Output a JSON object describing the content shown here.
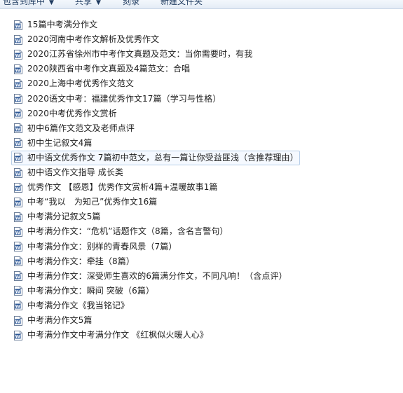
{
  "toolbar": {
    "include_label": "包含到库中",
    "share_label": "共享",
    "burn_label": "刻录",
    "new_folder_label": "新建文件夹"
  },
  "files": [
    {
      "name": "15篇中考满分作文",
      "icon": "word-doc-icon"
    },
    {
      "name": "2020河南中考作文解析及优秀作文",
      "icon": "word-doc-icon"
    },
    {
      "name": "2020江苏省徐州市中考作文真题及范文：当你需要时，有我",
      "icon": "word-doc-icon"
    },
    {
      "name": "2020陕西省中考作文真题及4篇范文：合唱",
      "icon": "word-doc-icon"
    },
    {
      "name": "2020上海中考优秀作文范文",
      "icon": "word-doc-icon"
    },
    {
      "name": "2020语文中考：福建优秀作文17篇（学习与性格）",
      "icon": "word-doc-icon"
    },
    {
      "name": "2020中考优秀作文赏析",
      "icon": "word-doc-icon"
    },
    {
      "name": "初中6篇作文范文及老师点评",
      "icon": "word-doc-icon"
    },
    {
      "name": "初中生记叙文4篇",
      "icon": "word-doc-icon"
    },
    {
      "name": "初中语文优秀作文 7篇初中范文，总有一篇让你受益匪浅（含推荐理由）",
      "icon": "word-doc-icon",
      "selected": true
    },
    {
      "name": "初中语文作文指导 成长类",
      "icon": "word-doc-icon"
    },
    {
      "name": "优秀作文 【感恩】优秀作文赏析4篇+温暖故事1篇",
      "icon": "word-doc-icon"
    },
    {
      "name": "中考“我以　为知己”优秀作文16篇",
      "icon": "word-doc-icon"
    },
    {
      "name": "中考满分记叙文5篇",
      "icon": "word-doc-icon"
    },
    {
      "name": "中考满分作文：“危机”话题作文（8篇，含名言警句）",
      "icon": "word-doc-icon"
    },
    {
      "name": "中考满分作文：别样的青春风景（7篇）",
      "icon": "word-doc-icon"
    },
    {
      "name": "中考满分作文：牵挂（8篇）",
      "icon": "word-doc-icon"
    },
    {
      "name": "中考满分作文：深受师生喜欢的6篇满分作文，不同凡响！（含点评）",
      "icon": "word-doc-icon"
    },
    {
      "name": "中考满分作文：瞬间 突破（6篇）",
      "icon": "word-doc-icon"
    },
    {
      "name": "中考满分作文《我当铭记》",
      "icon": "word-doc-icon"
    },
    {
      "name": "中考满分作文5篇",
      "icon": "word-doc-icon"
    },
    {
      "name": "中考满分作文中考满分作文 《红枫似火暖人心》",
      "icon": "word-doc-icon"
    }
  ],
  "colors": {
    "word_blue": "#2b5797",
    "selection_border": "#b8cfe8",
    "selection_fill": "#f5f9ff"
  }
}
